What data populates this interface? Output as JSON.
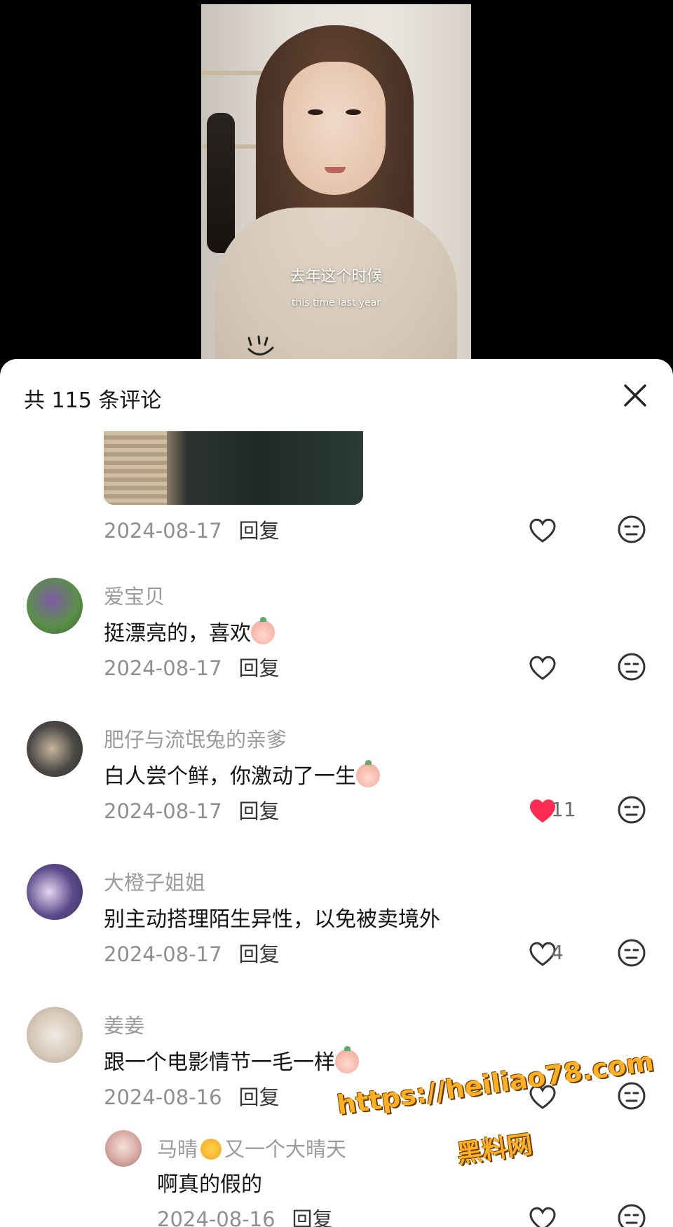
{
  "video": {
    "subtitle_cn": "去年这个时候",
    "subtitle_en": "this time last year"
  },
  "comments_panel": {
    "title": "共 115 条评论",
    "close_icon": "close-icon"
  },
  "colors": {
    "like_active": "#fe2c55",
    "text_primary": "#141414",
    "text_secondary": "#9a9a9a",
    "watermark": "#ffb020"
  },
  "comments": [
    {
      "name": "",
      "text": "",
      "date": "2024-08-17",
      "reply_label": "回复",
      "like_count": "",
      "liked": false
    },
    {
      "name": "爱宝贝",
      "text": "挺漂亮的，喜欢",
      "emoji": "peach-emoji",
      "date": "2024-08-17",
      "reply_label": "回复",
      "like_count": "",
      "liked": false
    },
    {
      "name": "肥仔与流氓兔的亲爹",
      "text": "白人尝个鲜，你激动了一生",
      "emoji": "peach-emoji",
      "date": "2024-08-17",
      "reply_label": "回复",
      "like_count": "11",
      "liked": true
    },
    {
      "name": "大橙子姐姐",
      "text": "别主动搭理陌生异性，以免被卖境外",
      "date": "2024-08-17",
      "reply_label": "回复",
      "like_count": "4",
      "liked": false
    },
    {
      "name": "姜姜",
      "text": "跟一个电影情节一毛一样",
      "emoji": "peach-emoji",
      "date": "2024-08-16",
      "reply_label": "回复",
      "like_count": "",
      "liked": false
    }
  ],
  "reply": {
    "name_part1": "马晴",
    "name_part2": "又一个大晴天",
    "name_emoji": "sun-emoji",
    "text": "啊真的假的",
    "date": "2024-08-16",
    "reply_label": "回复"
  },
  "watermark": {
    "url": "https://heiliao78.com",
    "site_name": "黑料网"
  }
}
